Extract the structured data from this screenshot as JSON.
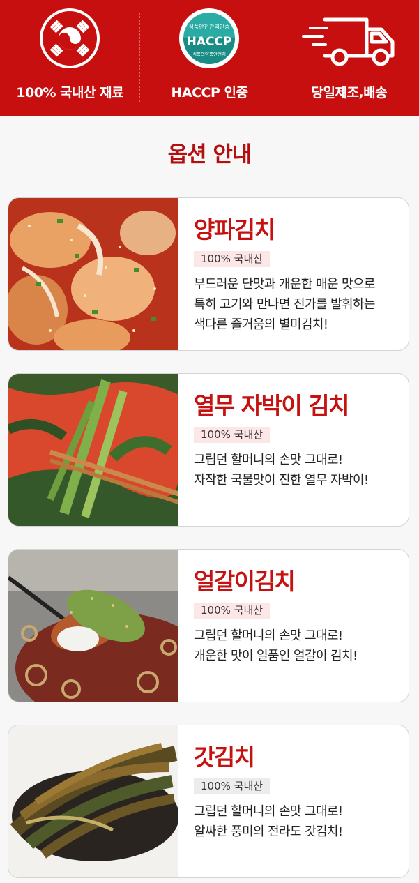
{
  "banner": {
    "background": "#c80f0f",
    "features": [
      {
        "icon": "korea-taegeuk-icon",
        "label": "100% 국내산 재료"
      },
      {
        "icon": "haccp-seal-icon",
        "label": "HACCP 인증",
        "seal_top_text": "식품안전관리인증",
        "seal_main_text": "HACCP",
        "seal_bottom_text": "식품의약품안전처"
      },
      {
        "icon": "delivery-truck-icon",
        "label": "당일제조,배송"
      }
    ]
  },
  "section_title": "옵션 안내",
  "accent_color": "#c5110f",
  "products": [
    {
      "name": "양파김치",
      "badge": "100% 국내산",
      "desc_line1": "부드러운 단맛과 개운한 매운 맛으로",
      "desc_line2": "특히 고기와 만나면 진가를 발휘하는",
      "desc_line3": "색다른 즐거움의 별미김치!",
      "image": "onion-kimchi-photo"
    },
    {
      "name": "열무 자박이 김치",
      "badge": "100% 국내산",
      "desc_line1": "그립던 할머니의 손맛 그대로!",
      "desc_line2": "자작한 국물맛이 진한 열무 자박이!",
      "image": "young-radish-kimchi-photo"
    },
    {
      "name": "얼갈이김치",
      "badge": "100% 국내산",
      "desc_line1": "그립던 할머니의 손맛 그대로!",
      "desc_line2": "개운한 맛이 일품인 얼갈이 김치!",
      "image": "eolgari-kimchi-photo"
    },
    {
      "name": "갓김치",
      "badge": "100% 국내산",
      "desc_line1": "그립던 할머니의 손맛 그대로!",
      "desc_line2": "알싸한 풍미의 전라도 갓김치!",
      "image": "mustard-leaf-kimchi-photo"
    }
  ]
}
